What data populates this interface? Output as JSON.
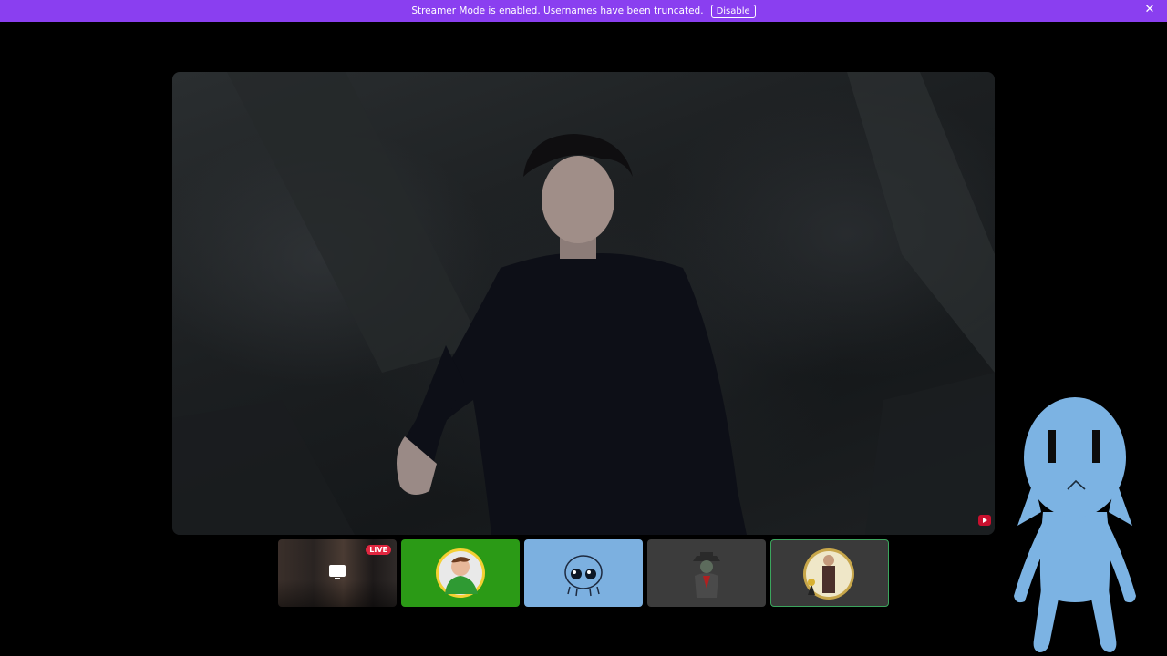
{
  "banner": {
    "message": "Streamer Mode is enabled. Usernames have been truncated.",
    "disable_label": "Disable",
    "close_glyph": "✕",
    "color": "#8a3ff0"
  },
  "stage": {
    "badge": "youtube-icon"
  },
  "tiles": [
    {
      "name": "screen-share",
      "live_label": "LIVE",
      "icon": "screen-share-icon"
    },
    {
      "name": "avatar-green",
      "color": "#2b9a16"
    },
    {
      "name": "avatar-blue-alien",
      "color": "#7cb0e0"
    },
    {
      "name": "avatar-grey-cowboy",
      "color": "#3c3c3c"
    },
    {
      "name": "avatar-speaking",
      "color": "#3a3a3a",
      "speaking": true
    }
  ]
}
